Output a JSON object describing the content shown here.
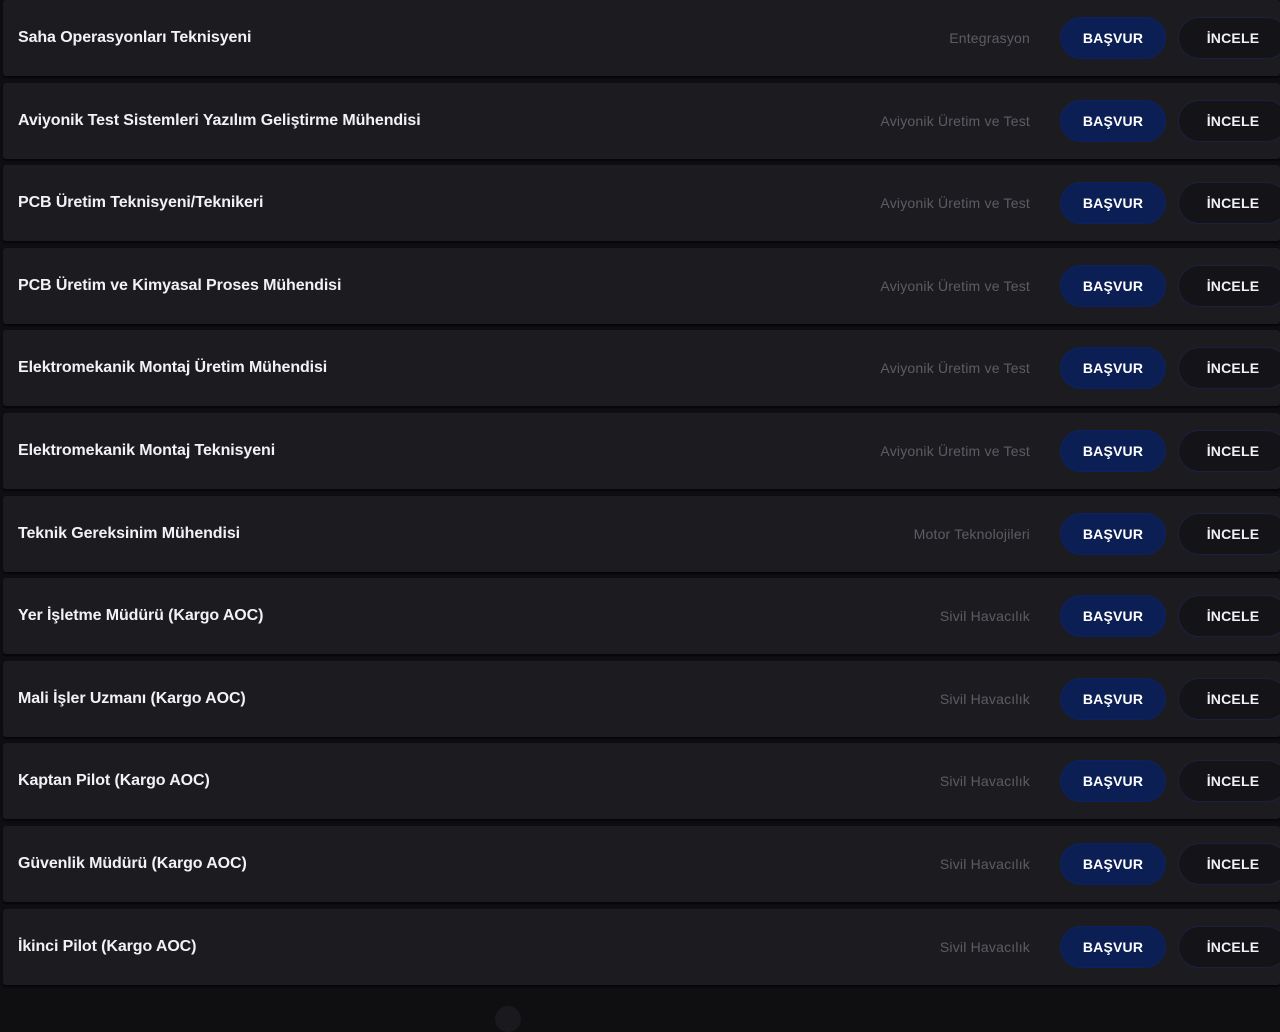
{
  "buttons": {
    "apply_label": "BAŞVUR",
    "review_label": "İNCELE"
  },
  "jobs": [
    {
      "title": "Saha Operasyonları Teknisyeni",
      "department": "Entegrasyon"
    },
    {
      "title": "Aviyonik Test Sistemleri Yazılım Geliştirme Mühendisi",
      "department": "Aviyonik Üretim ve Test"
    },
    {
      "title": "PCB Üretim Teknisyeni/Teknikeri",
      "department": "Aviyonik Üretim ve Test"
    },
    {
      "title": "PCB Üretim ve Kimyasal Proses Mühendisi",
      "department": "Aviyonik Üretim ve Test"
    },
    {
      "title": "Elektromekanik Montaj Üretim Mühendisi",
      "department": "Aviyonik Üretim ve Test"
    },
    {
      "title": "Elektromekanik Montaj Teknisyeni",
      "department": "Aviyonik Üretim ve Test"
    },
    {
      "title": "Teknik Gereksinim Mühendisi",
      "department": "Motor Teknolojileri"
    },
    {
      "title": "Yer İşletme Müdürü (Kargo AOC)",
      "department": "Sivil Havacılık"
    },
    {
      "title": "Mali İşler Uzmanı (Kargo AOC)",
      "department": "Sivil Havacılık"
    },
    {
      "title": "Kaptan Pilot (Kargo AOC)",
      "department": "Sivil Havacılık"
    },
    {
      "title": "Güvenlik Müdürü (Kargo AOC)",
      "department": "Sivil Havacılık"
    },
    {
      "title": "İkinci Pilot (Kargo AOC)",
      "department": "Sivil Havacılık"
    }
  ]
}
